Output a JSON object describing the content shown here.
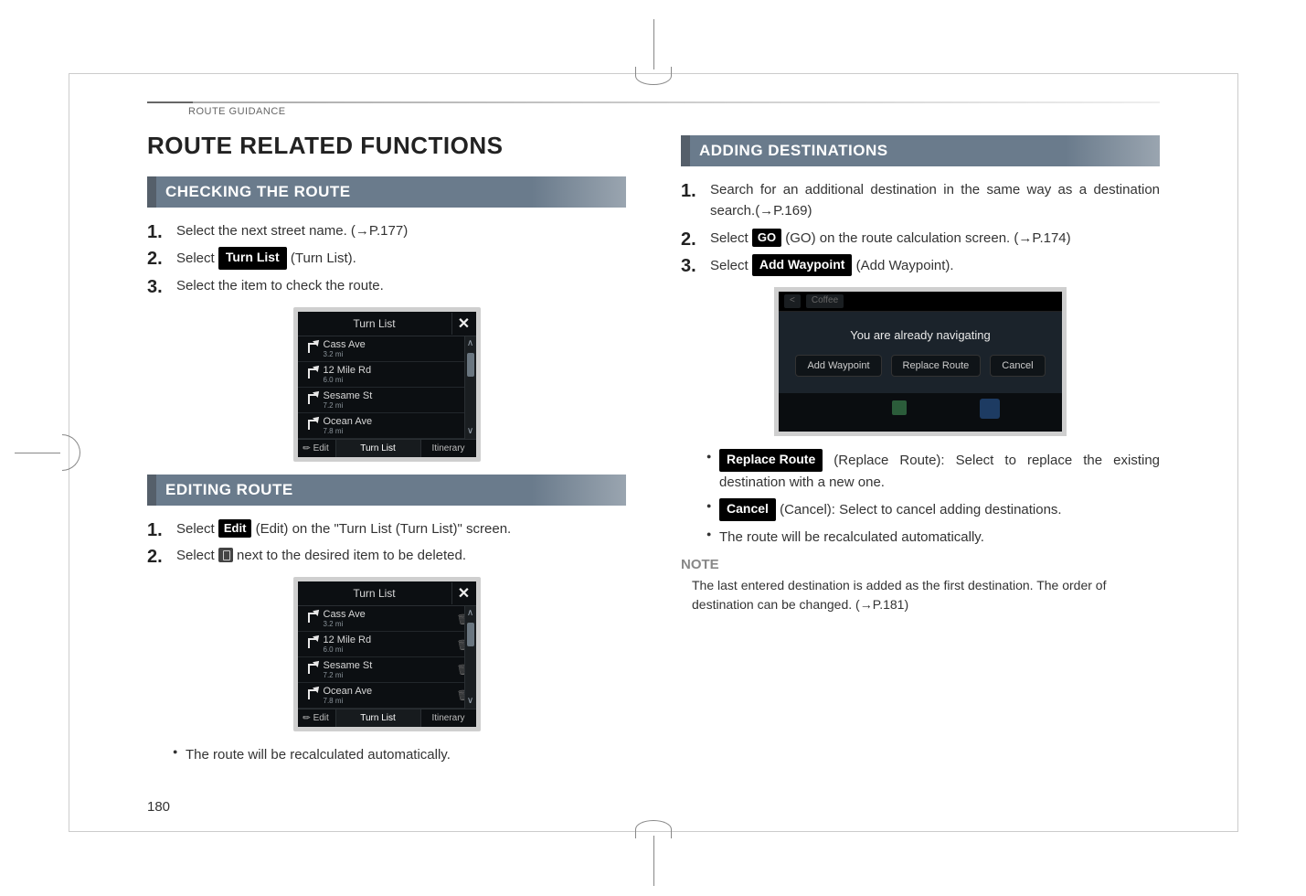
{
  "running_head": "ROUTE GUIDANCE",
  "page_title": "ROUTE RELATED FUNCTIONS",
  "page_number": "180",
  "left": {
    "section1": {
      "title": "CHECKING THE ROUTE",
      "step1": "Select the next street name. (→P.177)",
      "step2_pre": "Select ",
      "step2_btn": "Turn List",
      "step2_post": " (Turn List).",
      "step3": "Select the item to check the route."
    },
    "turnlist": {
      "head": "Turn List",
      "close": "✕",
      "rows": [
        {
          "name": "Cass Ave",
          "dist": "3.2 mi"
        },
        {
          "name": "12 Mile Rd",
          "dist": "6.0 mi"
        },
        {
          "name": "Sesame St",
          "dist": "7.2 mi"
        },
        {
          "name": "Ocean Ave",
          "dist": "7.8 mi"
        }
      ],
      "foot_edit": "Edit",
      "foot_cur": "Turn List",
      "foot_itn": "Itinerary"
    },
    "section2": {
      "title": "EDITING ROUTE",
      "step1_pre": "Select ",
      "step1_btn": "Edit",
      "step1_post": " (Edit) on the \"Turn List (Turn List)\" screen.",
      "step2_pre": "Select ",
      "step2_post": " next to the desired item to be deleted.",
      "bullet1": "The route will be recalculated automatically."
    }
  },
  "right": {
    "section": {
      "title": "ADDING DESTINATIONS",
      "step1": "Search for an additional destination in the same way as a destination search.(→P.169)",
      "step2_pre": "Select ",
      "step2_btn": "GO",
      "step2_post": " (GO) on the route calculation screen. (→P.174)",
      "step3_pre": "Select ",
      "step3_btn": "Add Waypoint",
      "step3_post": " (Add Waypoint)."
    },
    "popup": {
      "chip": "Coffee",
      "msg": "You are already navigating",
      "btn_add": "Add Waypoint",
      "btn_rep": "Replace Route",
      "btn_can": "Cancel"
    },
    "bullets": {
      "b1_btn": "Replace Route",
      "b1_text": " (Replace Route): Select to replace the existing destination with a new one.",
      "b2_btn": "Cancel",
      "b2_text": " (Cancel): Select to cancel adding destinations.",
      "b3": "The route will be recalculated automatically."
    },
    "note_head": "NOTE",
    "note_body": "The last entered destination is added as the first destination. The order of destination can be changed. (→P.181)"
  }
}
